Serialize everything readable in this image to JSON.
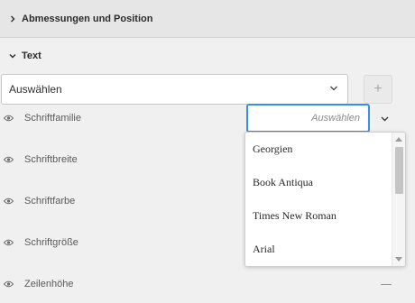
{
  "sections": {
    "dimensions": {
      "title": "Abmessungen und Position",
      "expanded": false
    },
    "text": {
      "title": "Text",
      "expanded": true
    }
  },
  "style_select": {
    "value": "Auswählen"
  },
  "add_button": {
    "label": "+"
  },
  "properties": [
    {
      "label": "Schriftfamilie"
    },
    {
      "label": "Schriftbreite"
    },
    {
      "label": "Schriftfarbe"
    },
    {
      "label": "Schriftgröße"
    },
    {
      "label": "Zeilenhöhe"
    }
  ],
  "font_family_input": {
    "placeholder": "Auswählen"
  },
  "font_dropdown": {
    "options": [
      "Georgien",
      "Book Antiqua",
      "Times New Roman",
      "Arial"
    ]
  },
  "line_height_value": "—",
  "icons": {
    "section_collapsed": "chevron-right-icon",
    "section_expanded": "chevron-down-icon",
    "visibility": "eye-icon"
  },
  "colors": {
    "focus_border": "#378ef0",
    "panel_bg": "#f0f0f0"
  }
}
